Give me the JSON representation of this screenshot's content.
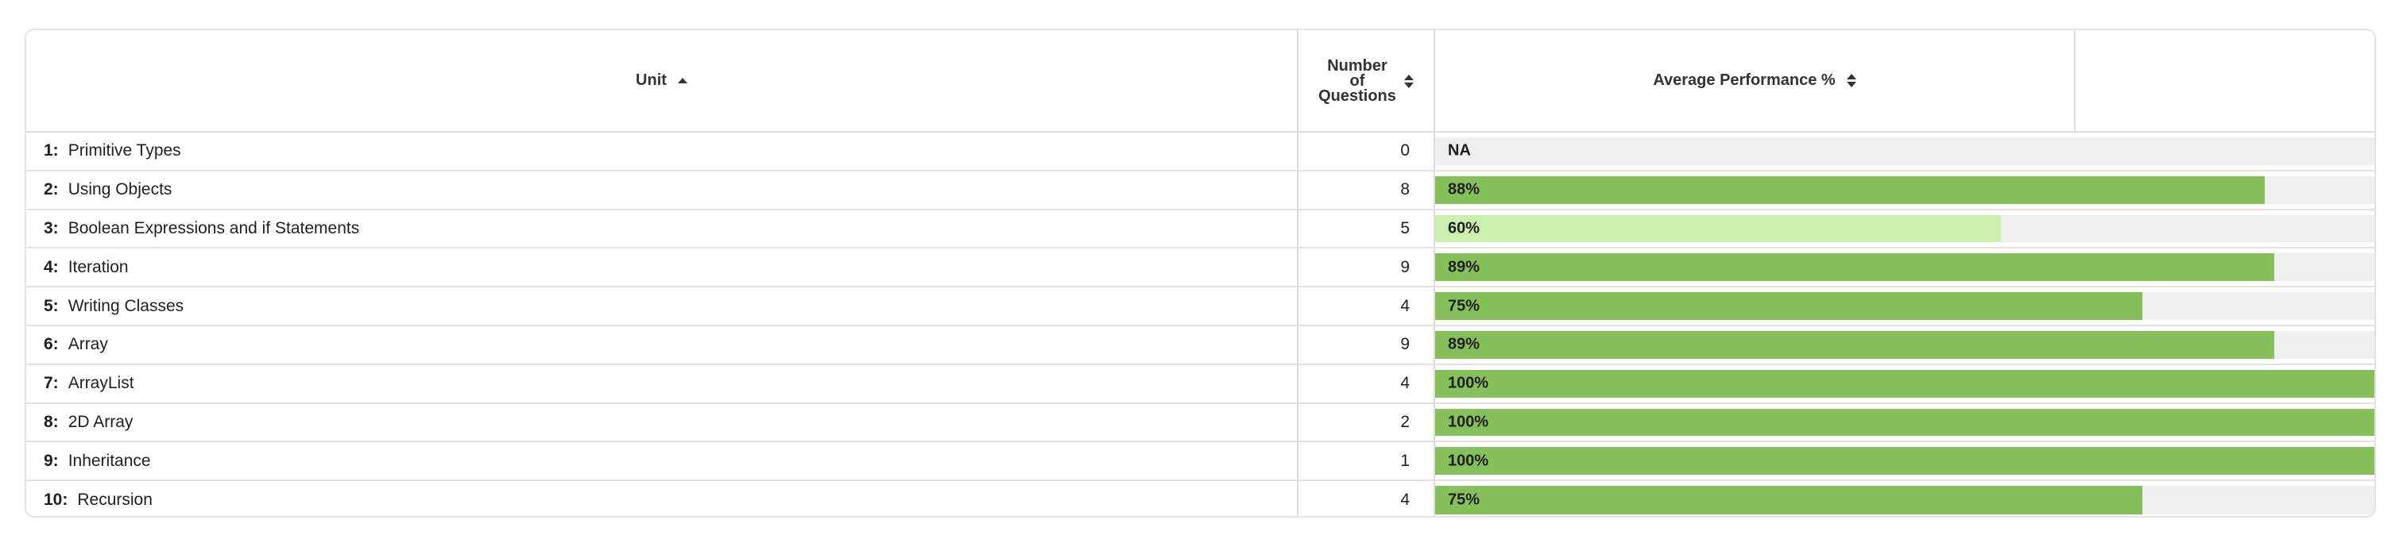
{
  "table": {
    "headers": {
      "unit": "Unit",
      "number_of_questions": [
        "Number",
        "of",
        "Questions"
      ],
      "average_performance": "Average Performance %"
    },
    "rows": [
      {
        "num": "1:",
        "name": "Primitive Types",
        "count": "0",
        "perf_label": "NA",
        "perf_value": null
      },
      {
        "num": "2:",
        "name": "Using Objects",
        "count": "8",
        "perf_label": "88%",
        "perf_value": 88
      },
      {
        "num": "3:",
        "name": "Boolean Expressions and if Statements",
        "count": "5",
        "perf_label": "60%",
        "perf_value": 60
      },
      {
        "num": "4:",
        "name": "Iteration",
        "count": "9",
        "perf_label": "89%",
        "perf_value": 89
      },
      {
        "num": "5:",
        "name": "Writing Classes",
        "count": "4",
        "perf_label": "75%",
        "perf_value": 75
      },
      {
        "num": "6:",
        "name": "Array",
        "count": "9",
        "perf_label": "89%",
        "perf_value": 89
      },
      {
        "num": "7:",
        "name": "ArrayList",
        "count": "4",
        "perf_label": "100%",
        "perf_value": 100
      },
      {
        "num": "8:",
        "name": "2D Array",
        "count": "2",
        "perf_label": "100%",
        "perf_value": 100
      },
      {
        "num": "9:",
        "name": "Inheritance",
        "count": "1",
        "perf_label": "100%",
        "perf_value": 100
      },
      {
        "num": "10:",
        "name": "Recursion",
        "count": "4",
        "perf_label": "75%",
        "perf_value": 75
      }
    ]
  },
  "colors": {
    "bar_high": "#86c05a",
    "bar_low": "#cbf0ae",
    "bar_track": "#efefef"
  }
}
